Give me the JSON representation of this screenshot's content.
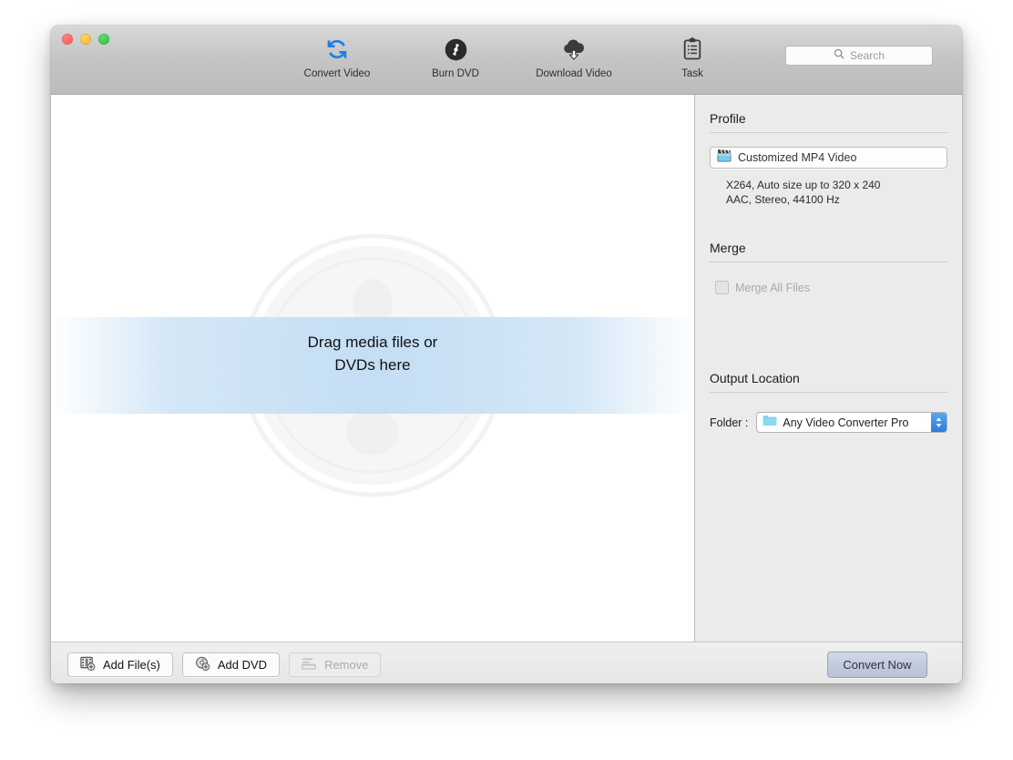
{
  "window": {
    "traffic_lights": [
      {
        "name": "close",
        "color": "#fa5953"
      },
      {
        "name": "minimize",
        "color": "#f8b52a"
      },
      {
        "name": "maximize",
        "color": "#2ec13f"
      }
    ]
  },
  "toolbar": {
    "items": [
      {
        "icon": "convert-video-icon",
        "label": "Convert Video",
        "active": true
      },
      {
        "icon": "burn-dvd-icon",
        "label": "Burn DVD",
        "active": false
      },
      {
        "icon": "download-video-icon",
        "label": "Download Video",
        "active": false
      },
      {
        "icon": "task-icon",
        "label": "Task",
        "active": false
      }
    ],
    "search": {
      "icon": "search-icon",
      "placeholder": "Search",
      "value": ""
    }
  },
  "drop_zone": {
    "line1": "Drag media files or",
    "line2": "DVDs here",
    "watermark_icon": "film-reel-watermark"
  },
  "sidebar": {
    "profile": {
      "title": "Profile",
      "selected_icon": "clapperboard-icon",
      "selected": "Customized MP4 Video",
      "detail_video": "X264, Auto size up to 320 x 240",
      "detail_audio": "AAC, Stereo, 44100 Hz"
    },
    "merge": {
      "title": "Merge",
      "checkbox_label": "Merge All Files",
      "checked": false,
      "disabled": true
    },
    "output": {
      "title": "Output Location",
      "folder_label": "Folder :",
      "folder_icon": "folder-icon",
      "folder_value": "Any Video Converter Pro"
    }
  },
  "bottom_bar": {
    "add_files": {
      "icon": "film-strip-add-icon",
      "label": "Add File(s)",
      "disabled": false
    },
    "add_dvd": {
      "icon": "dvd-add-icon",
      "label": "Add DVD",
      "disabled": false
    },
    "remove": {
      "icon": "remove-list-icon",
      "label": "Remove",
      "disabled": true
    },
    "convert_now": {
      "label": "Convert Now"
    }
  },
  "colors": {
    "accent_blue": "#1a7ee8",
    "stepper_blue": "#2b7ce0",
    "sidebar_bg": "#ebebeb",
    "band_blue": "#c4def4"
  }
}
